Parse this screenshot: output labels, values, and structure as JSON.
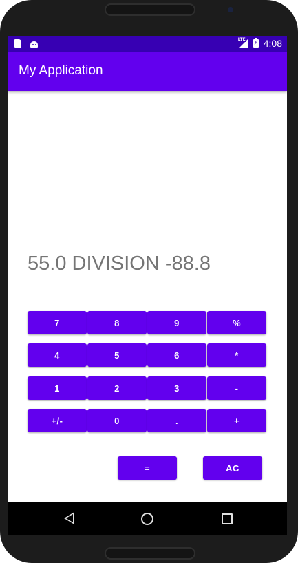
{
  "status_bar": {
    "time": "4:08",
    "network_label": "LTE",
    "icons": [
      "sd-card-icon",
      "android-debug-icon",
      "lte-signal-icon",
      "battery-charging-icon"
    ]
  },
  "app_bar": {
    "title": "My Application"
  },
  "display": {
    "text": "55.0 DIVISION -88.8"
  },
  "keypad": {
    "rows": [
      [
        "7",
        "8",
        "9",
        "%"
      ],
      [
        "4",
        "5",
        "6",
        "*"
      ],
      [
        "1",
        "2",
        "3",
        "-"
      ],
      [
        "+/-",
        "0",
        ".",
        "+"
      ]
    ]
  },
  "actions": {
    "equals_label": "=",
    "clear_label": "AC"
  },
  "nav_bar": {
    "icons": [
      "back-icon",
      "home-icon",
      "recents-icon"
    ]
  },
  "colors": {
    "primary": "#6200ee",
    "primary_dark": "#3700b3",
    "display_text": "#757575",
    "background": "#ffffff"
  }
}
